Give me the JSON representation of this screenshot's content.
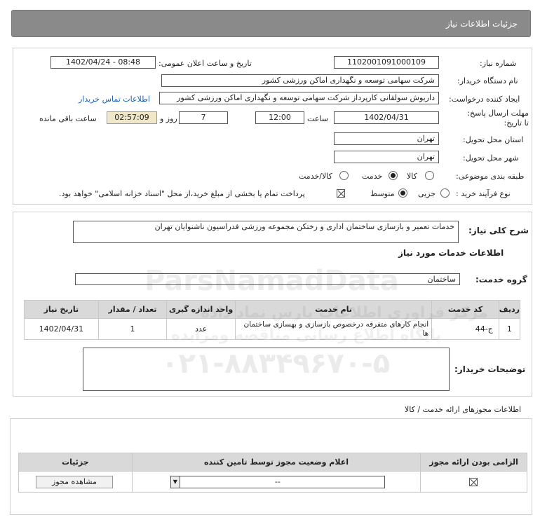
{
  "header": {
    "title": "جزئیات اطلاعات نیاز"
  },
  "form": {
    "need_number_label": "شماره نیاز:",
    "need_number": "1102001091000109",
    "announce_datetime_label": "تاریخ و ساعت اعلان عمومی:",
    "announce_datetime": "1402/04/24 - 08:48",
    "buyer_org_label": "نام دستگاه خریدار:",
    "buyer_org": "شرکت سهامی توسعه و نگهداری اماکن ورزشی کشور",
    "requester_label": "ایجاد کننده درخواست:",
    "requester": "داریوش سولقانی کارپرداز شرکت سهامی توسعه و نگهداری اماکن ورزشی کشور",
    "buyer_contact_link": "اطلاعات تماس خریدار",
    "deadline_label": "مهلت ارسال پاسخ: تا تاریخ:",
    "deadline_date": "1402/04/31",
    "time_label": "ساعت",
    "deadline_time": "12:00",
    "days_value": "7",
    "days_label": "روز و",
    "remaining_time": "02:57:09",
    "remaining_label": "ساعت باقی مانده",
    "province_label": "استان محل تحویل:",
    "province": "تهران",
    "city_label": "شهر محل تحویل:",
    "city": "تهران",
    "category_label": "طبقه بندی موضوعی:",
    "category_options": [
      "کالا",
      "خدمت",
      "کالا/خدمت"
    ],
    "category_selected": "خدمت",
    "purchase_type_label": "نوع فرآیند خرید :",
    "purchase_options": [
      "جزیی",
      "متوسط"
    ],
    "purchase_selected": "متوسط",
    "treasury_note": "پرداخت تمام یا بخشی از مبلغ خرید،از محل \"اسناد خزانه اسلامی\" خواهد بود."
  },
  "details": {
    "summary_label": "شرح کلی نیاز:",
    "summary": "خدمات تعمیر و بازسازی ساختمان اداری و رختکن مجموعه ورزشی فدراسیون ناشنوایان تهران",
    "services_heading": "اطلاعات خدمات مورد نیاز",
    "service_group_label": "گروه خدمت:",
    "service_group": "ساختمان",
    "table": {
      "headers": [
        "ردیف",
        "کد خدمت",
        "نام خدمت",
        "واحد اندازه گیری",
        "تعداد / مقدار",
        "تاریخ نیاز"
      ],
      "rows": [
        [
          "1",
          "ج-44",
          "انجام کارهای متفرقه درخصوص بازسازی و بهسازی ساختمان ها",
          "عدد",
          "1",
          "1402/04/31"
        ]
      ]
    },
    "buyer_notes_label": "توضیحات خریدار:"
  },
  "permits": {
    "heading": "اطلاعات مجوزهای ارائه خدمت / کالا",
    "headers": [
      "الزامی بودن ارائه مجوز",
      "اعلام وضعیت مجوز توسط تامین کننده",
      "جزئیات"
    ],
    "status_value": "--",
    "view_button": "مشاهده مجوز"
  },
  "watermark": {
    "brand": "ParsNamadData",
    "line1": "مرکز فراوری اطلاعات پارس نماد داده",
    "line2": "پایگاه اطلاع رسانی مناقصه ومزایده",
    "phone": "۰۲۱-۸۸۳۴۹۶۷۰-۵"
  }
}
